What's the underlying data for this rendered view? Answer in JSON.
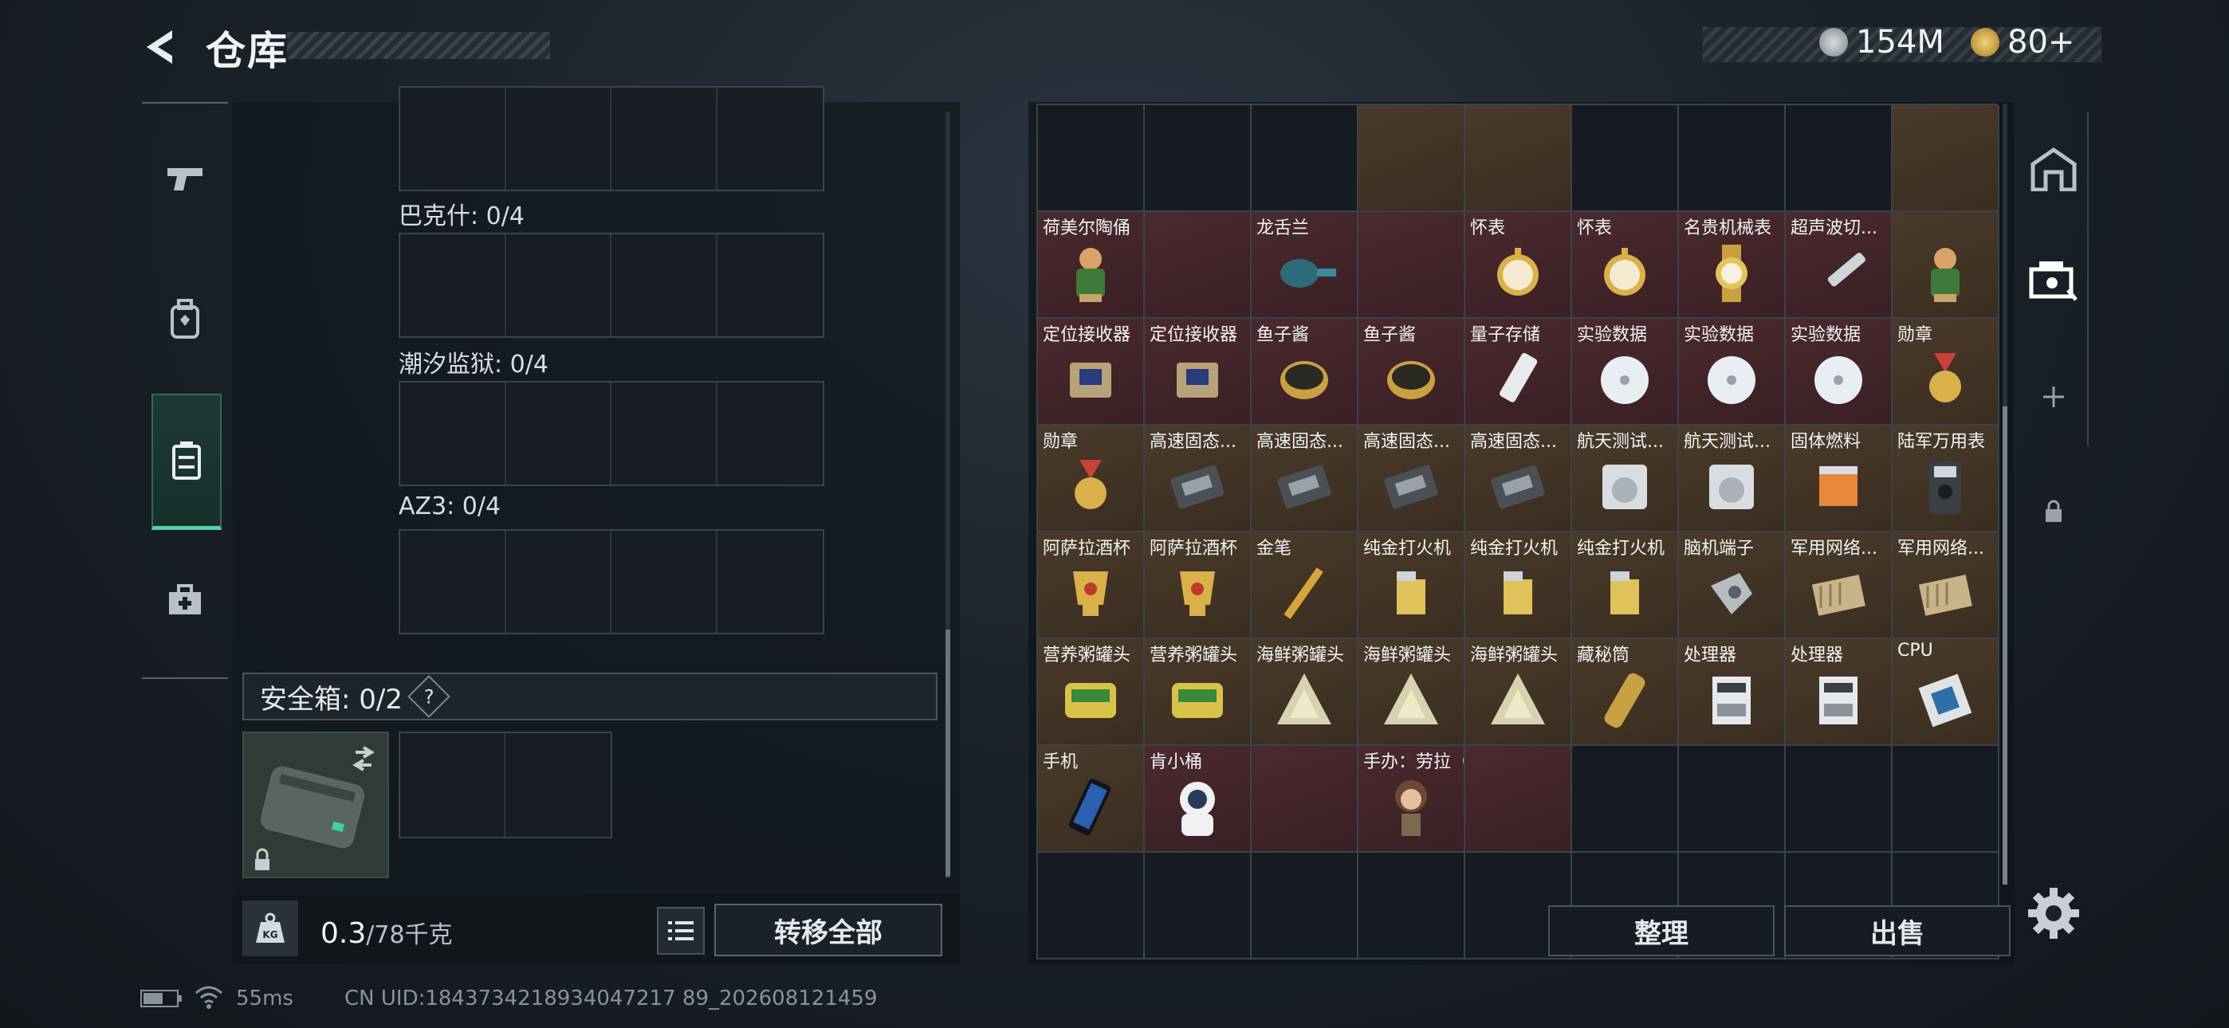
{
  "header": {
    "title": "仓库",
    "currency_silver": "154M",
    "currency_gold": "80+"
  },
  "left_panel": {
    "slot_labels": [
      "巴克什: 0/4",
      "潮汐监狱: 0/4",
      "AZ3: 0/4"
    ],
    "safe_box_label": "安全箱: 0/2",
    "help_mark": "?",
    "weight_value": "0.3",
    "weight_max": "/78千克",
    "transfer_all": "转移全部"
  },
  "right_panel": {
    "sort": "整理",
    "sell": "出售",
    "items": [
      {
        "name": "",
        "tone": "empty"
      },
      {
        "name": "",
        "tone": "empty"
      },
      {
        "name": "",
        "tone": "empty"
      },
      {
        "name": "",
        "tone": "gold"
      },
      {
        "name": "",
        "tone": "gold"
      },
      {
        "name": "",
        "tone": "empty"
      },
      {
        "name": "",
        "tone": "empty"
      },
      {
        "name": "",
        "tone": "empty"
      },
      {
        "name": "",
        "tone": "gold"
      },
      {
        "name": "荷美尔陶俑",
        "tone": "red",
        "icon": "figurine-icon"
      },
      {
        "name": "",
        "tone": "red"
      },
      {
        "name": "龙舌兰",
        "tone": "red",
        "icon": "bottle-icon"
      },
      {
        "name": "",
        "tone": "red"
      },
      {
        "name": "怀表",
        "tone": "red",
        "icon": "pocket-watch-icon"
      },
      {
        "name": "怀表",
        "tone": "red",
        "icon": "pocket-watch-icon"
      },
      {
        "name": "名贵机械表",
        "tone": "red",
        "icon": "wristwatch-icon"
      },
      {
        "name": "超声波切...",
        "tone": "red",
        "icon": "cutter-icon"
      },
      {
        "name": "",
        "tone": "gold",
        "icon": "figurine-icon"
      },
      {
        "name": "定位接收器",
        "tone": "red",
        "icon": "receiver-icon"
      },
      {
        "name": "定位接收器",
        "tone": "red",
        "icon": "receiver-icon"
      },
      {
        "name": "鱼子酱",
        "tone": "red",
        "icon": "caviar-icon"
      },
      {
        "name": "鱼子酱",
        "tone": "red",
        "icon": "caviar-icon"
      },
      {
        "name": "量子存储",
        "tone": "red",
        "icon": "usb-icon"
      },
      {
        "name": "实验数据",
        "tone": "red",
        "icon": "disc-icon"
      },
      {
        "name": "实验数据",
        "tone": "red",
        "icon": "disc-icon"
      },
      {
        "name": "实验数据",
        "tone": "red",
        "icon": "disc-icon"
      },
      {
        "name": "勋章",
        "tone": "gold",
        "icon": "medal-icon"
      },
      {
        "name": "勋章",
        "tone": "gold",
        "icon": "medal-icon"
      },
      {
        "name": "高速固态...",
        "tone": "gold",
        "icon": "ssd-icon"
      },
      {
        "name": "高速固态...",
        "tone": "gold",
        "icon": "ssd-icon"
      },
      {
        "name": "高速固态...",
        "tone": "gold",
        "icon": "ssd-icon"
      },
      {
        "name": "高速固态...",
        "tone": "gold",
        "icon": "ssd-icon"
      },
      {
        "name": "航天测试...",
        "tone": "gold",
        "icon": "drive-icon"
      },
      {
        "name": "航天测试...",
        "tone": "gold",
        "icon": "drive-icon"
      },
      {
        "name": "固体燃料",
        "tone": "gold",
        "icon": "fuel-icon"
      },
      {
        "name": "陆军万用表",
        "tone": "gold",
        "icon": "multimeter-icon"
      },
      {
        "name": "阿萨拉酒杯",
        "tone": "gold",
        "icon": "cup-icon"
      },
      {
        "name": "阿萨拉酒杯",
        "tone": "gold",
        "icon": "cup-icon"
      },
      {
        "name": "金笔",
        "tone": "gold",
        "icon": "pen-icon"
      },
      {
        "name": "纯金打火机",
        "tone": "gold",
        "icon": "lighter-icon"
      },
      {
        "name": "纯金打火机",
        "tone": "gold",
        "icon": "lighter-icon"
      },
      {
        "name": "纯金打火机",
        "tone": "gold",
        "icon": "lighter-icon"
      },
      {
        "name": "脑机端子",
        "tone": "gold",
        "icon": "terminal-icon"
      },
      {
        "name": "军用网络...",
        "tone": "gold",
        "icon": "network-icon"
      },
      {
        "name": "军用网络...",
        "tone": "gold",
        "icon": "network-icon"
      },
      {
        "name": "营养粥罐头",
        "tone": "gold",
        "icon": "can-icon"
      },
      {
        "name": "营养粥罐头",
        "tone": "gold",
        "icon": "can-icon"
      },
      {
        "name": "海鲜粥罐头",
        "tone": "gold",
        "icon": "triangle-can-icon"
      },
      {
        "name": "海鲜粥罐头",
        "tone": "gold",
        "icon": "triangle-can-icon"
      },
      {
        "name": "海鲜粥罐头",
        "tone": "gold",
        "icon": "triangle-can-icon"
      },
      {
        "name": "藏秘筒",
        "tone": "gold",
        "icon": "cylinder-icon"
      },
      {
        "name": "处理器",
        "tone": "gold",
        "icon": "processor-icon"
      },
      {
        "name": "处理器",
        "tone": "gold",
        "icon": "processor-icon"
      },
      {
        "name": "CPU",
        "tone": "gold",
        "icon": "cpu-icon"
      },
      {
        "name": "手机",
        "tone": "gold",
        "icon": "phone-icon"
      },
      {
        "name": "肯小桶",
        "tone": "red",
        "icon": "astronaut-icon"
      },
      {
        "name": "",
        "tone": "red"
      },
      {
        "name": "手办：劳拉（崛起）",
        "tone": "red",
        "icon": "figure-icon"
      },
      {
        "name": "",
        "tone": "red"
      },
      {
        "name": "",
        "tone": "empty"
      },
      {
        "name": "",
        "tone": "empty"
      },
      {
        "name": "",
        "tone": "empty"
      },
      {
        "name": "",
        "tone": "empty"
      },
      {
        "name": "",
        "tone": "empty"
      },
      {
        "name": "",
        "tone": "empty"
      },
      {
        "name": "",
        "tone": "empty"
      },
      {
        "name": "",
        "tone": "empty"
      },
      {
        "name": "",
        "tone": "empty"
      },
      {
        "name": "",
        "tone": "empty"
      },
      {
        "name": "",
        "tone": "empty"
      },
      {
        "name": "",
        "tone": "empty"
      },
      {
        "name": "",
        "tone": "empty"
      }
    ]
  },
  "status": {
    "ping": "55ms",
    "uid": "CN UID:1843734218934047217 89_202608121459"
  }
}
